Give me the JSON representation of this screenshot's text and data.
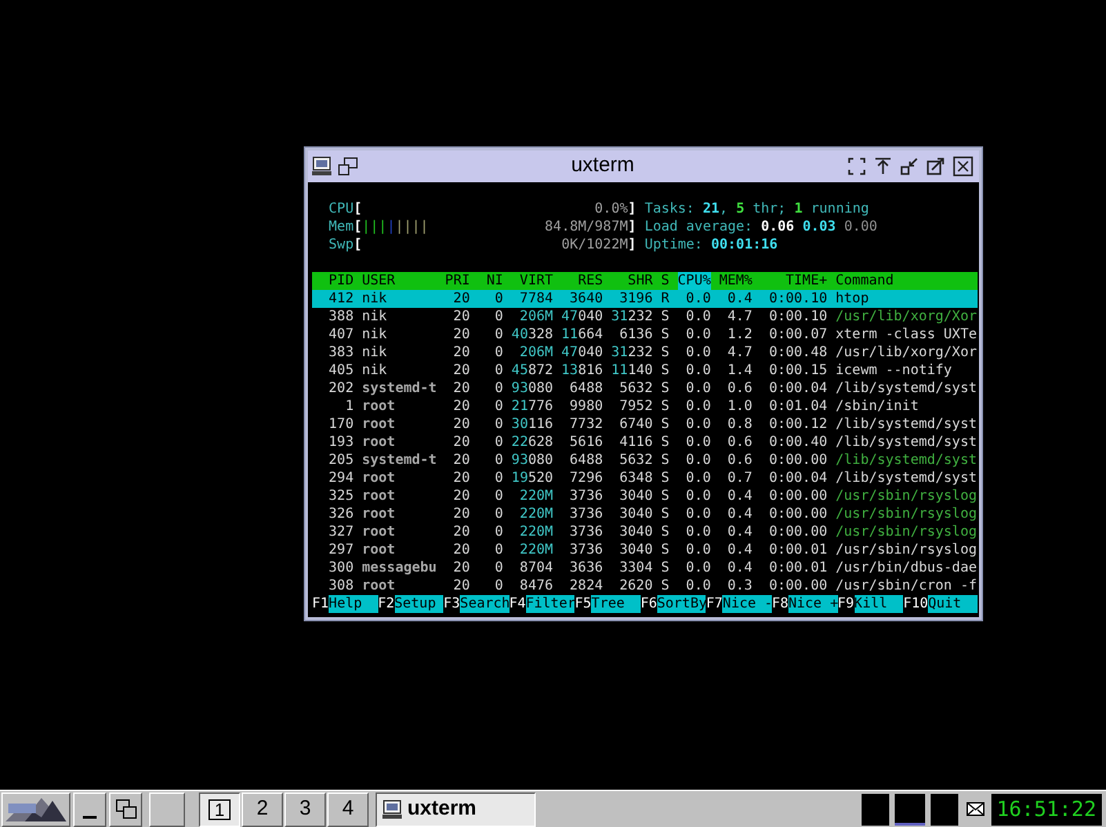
{
  "window": {
    "title": "uxterm"
  },
  "meters": [
    {
      "label": "CPU",
      "open": "[",
      "reading": "0.0%",
      "close": "]"
    },
    {
      "label": "Mem",
      "open": "[",
      "segments": [
        {
          "text": "|||",
          "color": "#20c020"
        },
        {
          "text": "|",
          "color": "#2040c0"
        },
        {
          "text": "||||",
          "color": "#a0a070"
        }
      ],
      "reading": "84.8M/987M",
      "close": "]"
    },
    {
      "label": "Swp",
      "open": "[",
      "reading": "0K/1022M",
      "close": "]"
    }
  ],
  "summary": [
    [
      {
        "text": "Tasks: ",
        "kind": "label"
      },
      {
        "text": "21",
        "kind": "value"
      },
      {
        "text": ", ",
        "kind": "label"
      },
      {
        "text": "5",
        "kind": "accent"
      },
      {
        "text": " thr; ",
        "kind": "label"
      },
      {
        "text": "1",
        "kind": "accent"
      },
      {
        "text": " running",
        "kind": "label"
      }
    ],
    [
      {
        "text": "Load average: ",
        "kind": "label"
      },
      {
        "text": "0.06",
        "kind": "bold"
      },
      {
        "text": " 0.03",
        "kind": "value"
      },
      {
        "text": " 0.00",
        "kind": "dim"
      }
    ],
    [
      {
        "text": "Uptime: ",
        "kind": "label"
      },
      {
        "text": "00:01:16",
        "kind": "value"
      }
    ]
  ],
  "columns": [
    {
      "label": "PID",
      "selected": false
    },
    {
      "label": "USER",
      "selected": false
    },
    {
      "label": "PRI",
      "selected": false
    },
    {
      "label": "NI",
      "selected": false
    },
    {
      "label": "VIRT",
      "selected": false
    },
    {
      "label": "RES",
      "selected": false
    },
    {
      "label": "SHR",
      "selected": false
    },
    {
      "label": "S",
      "selected": false
    },
    {
      "label": "CPU%",
      "selected": true
    },
    {
      "label": "MEM%",
      "selected": false
    },
    {
      "label": "TIME+",
      "selected": false
    },
    {
      "label": "Command",
      "selected": false
    }
  ],
  "rows": [
    {
      "cells": [
        "412",
        "nik",
        "20",
        "0",
        "7784",
        "3640",
        "3196",
        "R",
        "0.0",
        "0.4",
        "0:00.10",
        "htop"
      ],
      "selected": true,
      "user_dimmed": false
    },
    {
      "cells": [
        "388",
        "nik",
        "20",
        "0",
        "206M",
        "47040",
        "31232",
        "S",
        "0.0",
        "4.7",
        "0:00.10",
        "/usr/lib/xorg/Xor"
      ],
      "selected": false,
      "user_dimmed": false,
      "thread": true
    },
    {
      "cells": [
        "407",
        "nik",
        "20",
        "0",
        "40328",
        "11664",
        "6136",
        "S",
        "0.0",
        "1.2",
        "0:00.07",
        "xterm -class UXTe"
      ],
      "selected": false,
      "user_dimmed": false,
      "thread": false
    },
    {
      "cells": [
        "383",
        "nik",
        "20",
        "0",
        "206M",
        "47040",
        "31232",
        "S",
        "0.0",
        "4.7",
        "0:00.48",
        "/usr/lib/xorg/Xor"
      ],
      "selected": false,
      "user_dimmed": false,
      "thread": false
    },
    {
      "cells": [
        "405",
        "nik",
        "20",
        "0",
        "45872",
        "13816",
        "11140",
        "S",
        "0.0",
        "1.4",
        "0:00.15",
        "icewm --notify"
      ],
      "selected": false,
      "user_dimmed": false,
      "thread": false
    },
    {
      "cells": [
        "202",
        "systemd-t",
        "20",
        "0",
        "93080",
        "6488",
        "5632",
        "S",
        "0.0",
        "0.6",
        "0:00.04",
        "/lib/systemd/syst"
      ],
      "selected": false,
      "user_dimmed": true,
      "thread": false
    },
    {
      "cells": [
        "1",
        "root",
        "20",
        "0",
        "21776",
        "9980",
        "7952",
        "S",
        "0.0",
        "1.0",
        "0:01.04",
        "/sbin/init"
      ],
      "selected": false,
      "user_dimmed": true,
      "thread": false
    },
    {
      "cells": [
        "170",
        "root",
        "20",
        "0",
        "30116",
        "7732",
        "6740",
        "S",
        "0.0",
        "0.8",
        "0:00.12",
        "/lib/systemd/syst"
      ],
      "selected": false,
      "user_dimmed": true,
      "thread": false
    },
    {
      "cells": [
        "193",
        "root",
        "20",
        "0",
        "22628",
        "5616",
        "4116",
        "S",
        "0.0",
        "0.6",
        "0:00.40",
        "/lib/systemd/syst"
      ],
      "selected": false,
      "user_dimmed": true,
      "thread": false
    },
    {
      "cells": [
        "205",
        "systemd-t",
        "20",
        "0",
        "93080",
        "6488",
        "5632",
        "S",
        "0.0",
        "0.6",
        "0:00.00",
        "/lib/systemd/syst"
      ],
      "selected": false,
      "user_dimmed": true,
      "thread": true
    },
    {
      "cells": [
        "294",
        "root",
        "20",
        "0",
        "19520",
        "7296",
        "6348",
        "S",
        "0.0",
        "0.7",
        "0:00.04",
        "/lib/systemd/syst"
      ],
      "selected": false,
      "user_dimmed": true,
      "thread": false
    },
    {
      "cells": [
        "325",
        "root",
        "20",
        "0",
        "220M",
        "3736",
        "3040",
        "S",
        "0.0",
        "0.4",
        "0:00.00",
        "/usr/sbin/rsyslog"
      ],
      "selected": false,
      "user_dimmed": true,
      "thread": true
    },
    {
      "cells": [
        "326",
        "root",
        "20",
        "0",
        "220M",
        "3736",
        "3040",
        "S",
        "0.0",
        "0.4",
        "0:00.00",
        "/usr/sbin/rsyslog"
      ],
      "selected": false,
      "user_dimmed": true,
      "thread": true
    },
    {
      "cells": [
        "327",
        "root",
        "20",
        "0",
        "220M",
        "3736",
        "3040",
        "S",
        "0.0",
        "0.4",
        "0:00.00",
        "/usr/sbin/rsyslog"
      ],
      "selected": false,
      "user_dimmed": true,
      "thread": true
    },
    {
      "cells": [
        "297",
        "root",
        "20",
        "0",
        "220M",
        "3736",
        "3040",
        "S",
        "0.0",
        "0.4",
        "0:00.01",
        "/usr/sbin/rsyslog"
      ],
      "selected": false,
      "user_dimmed": true,
      "thread": false
    },
    {
      "cells": [
        "300",
        "messagebu",
        "20",
        "0",
        "8704",
        "3636",
        "3304",
        "S",
        "0.0",
        "0.4",
        "0:00.01",
        "/usr/bin/dbus-dae"
      ],
      "selected": false,
      "user_dimmed": true,
      "thread": false
    },
    {
      "cells": [
        "308",
        "root",
        "20",
        "0",
        "8476",
        "2824",
        "2620",
        "S",
        "0.0",
        "0.3",
        "0:00.00",
        "/usr/sbin/cron -f"
      ],
      "selected": false,
      "user_dimmed": true,
      "thread": false
    }
  ],
  "function_keys": [
    {
      "key": "F1",
      "label": "Help"
    },
    {
      "key": "F2",
      "label": "Setup"
    },
    {
      "key": "F3",
      "label": "Search"
    },
    {
      "key": "F4",
      "label": "Filter"
    },
    {
      "key": "F5",
      "label": "Tree"
    },
    {
      "key": "F6",
      "label": "SortBy"
    },
    {
      "key": "F7",
      "label": "Nice -"
    },
    {
      "key": "F8",
      "label": "Nice +"
    },
    {
      "key": "F9",
      "label": "Kill"
    },
    {
      "key": "F10",
      "label": "Quit"
    }
  ],
  "taskbar": {
    "workspaces": [
      {
        "label": "1",
        "selected": true
      },
      {
        "label": "2",
        "selected": false
      },
      {
        "label": "3",
        "selected": false
      },
      {
        "label": "4",
        "selected": false
      }
    ],
    "tasks": [
      {
        "label": "uxterm",
        "selected": true
      }
    ],
    "clock": "16:51:22"
  }
}
